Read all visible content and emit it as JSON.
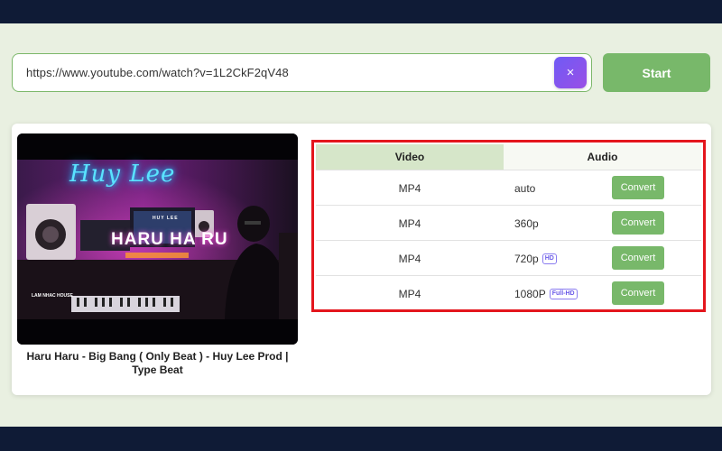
{
  "search": {
    "url": "https://www.youtube.com/watch?v=1L2CkF2qV48",
    "clear_symbol": "×",
    "start_label": "Start"
  },
  "video": {
    "thumbnail_text": {
      "neon_sign": "Huy Lee",
      "small_caption": "HUY LEE",
      "main_title": "HARU HA RU",
      "channel_caption": "LAM NHAC HOUSE"
    },
    "title": "Haru Haru - Big Bang ( Only Beat ) - Huy Lee Prod | Type Beat"
  },
  "formats": {
    "tabs": [
      "Video",
      "Audio"
    ],
    "active_tab": "Video",
    "rows": [
      {
        "format": "MP4",
        "quality": "auto",
        "badge": "",
        "action": "Convert"
      },
      {
        "format": "MP4",
        "quality": "360p",
        "badge": "",
        "action": "Convert"
      },
      {
        "format": "MP4",
        "quality": "720p",
        "badge": "HD",
        "action": "Convert"
      },
      {
        "format": "MP4",
        "quality": "1080P",
        "badge": "Full-HD",
        "action": "Convert"
      }
    ]
  },
  "colors": {
    "accent_green": "#78b86a",
    "highlight_border": "#e4161d",
    "clear_button": "#7a56f0",
    "header_band": "#0f1b36"
  }
}
